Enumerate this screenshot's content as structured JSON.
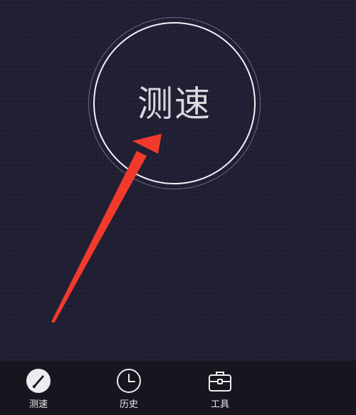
{
  "main": {
    "speed_test_button_label": "测速"
  },
  "bottom_nav": {
    "tabs": [
      {
        "label": "测速",
        "icon": "gauge-icon",
        "active": true
      },
      {
        "label": "历史",
        "icon": "clock-icon",
        "active": false
      },
      {
        "label": "工具",
        "icon": "toolbox-icon",
        "active": false
      }
    ]
  },
  "colors": {
    "background": "#1f1e33",
    "nav_background": "#17161f",
    "circle_stroke": "#f2f2f5",
    "annotation_arrow": "#f23a2c"
  }
}
